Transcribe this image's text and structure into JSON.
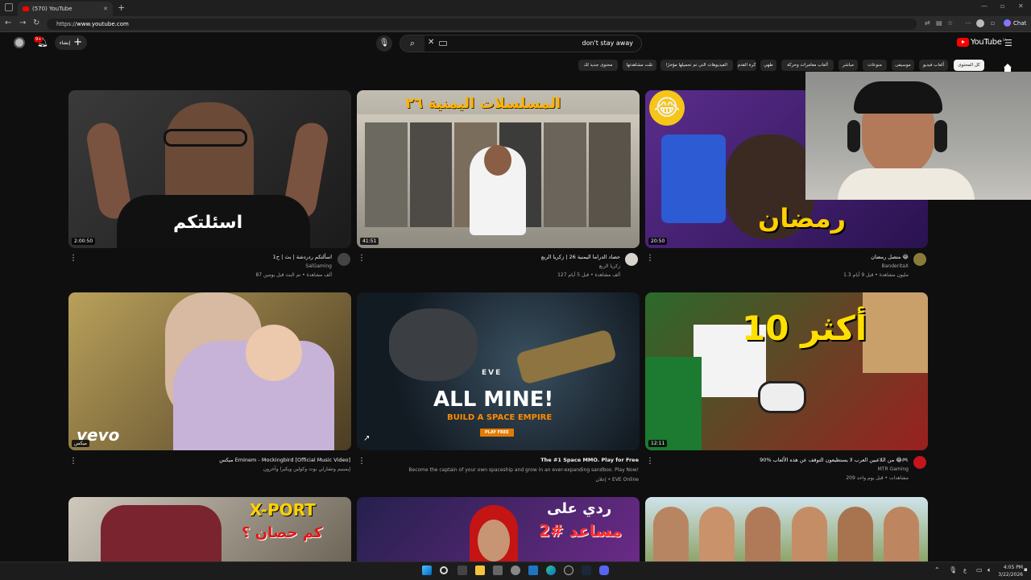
{
  "browser": {
    "tab_title": "(570) YouTube",
    "url_prefix": "https://",
    "url_host": "www.youtube.com",
    "chat_label": "Chat",
    "icons": [
      "back-icon",
      "forward-icon",
      "reload-icon",
      "site-info-icon",
      "translate-icon",
      "reader-icon",
      "star-icon",
      "more-icon",
      "profile-icon"
    ]
  },
  "youtube": {
    "create_label": "إنشاء",
    "notification_count": "9+",
    "search_query": "don't stay away",
    "logo_text": "YouTube",
    "logo_region": "SA",
    "chips": [
      {
        "label": "كل المحتوى",
        "active": true
      },
      {
        "label": "ألعاب فيديو"
      },
      {
        "label": "موسيقى"
      },
      {
        "label": "منوعات"
      },
      {
        "label": "مباشر"
      },
      {
        "label": "ألعاب مغامرات وحركة"
      },
      {
        "label": "طهي"
      },
      {
        "label": "كرة القدم"
      },
      {
        "label": "الفيديوهات التي تم تحميلها مؤخرًا"
      },
      {
        "label": "تمّت مشاهدتها"
      },
      {
        "label": "محتوى جديد لك"
      }
    ],
    "videos": [
      {
        "title": "اسألتكم ردردشة | بث | ح1",
        "channel": "SalGaming",
        "meta": "87 ألف مشاهدة • تم البث قبل يومين",
        "duration": "2:00:50",
        "overlay": "اسئلتكم"
      },
      {
        "title": "حصاد الدراما اليمنية 26 | زكريا الربع",
        "channel": "زكريا الربع",
        "meta": "127 ألف مشاهدة • قبل 5 أيام",
        "duration": "41:51",
        "overlay": "المسلسلات اليمنية ٢٦"
      },
      {
        "title": "متصل رمضان 😂",
        "channel": "BanderitaX",
        "meta": "1.3 مليون مشاهدة • قبل 9 أيام",
        "duration": "20:50",
        "overlay": "رمضان"
      },
      {
        "title": "ميكس Eminem - Mockingbird [Official Music Video]",
        "channel": "إيمينيم وتشارلي بوث وكولين ويكيرا وآخرون",
        "meta": "",
        "duration": "ميكس",
        "overlay": "vevo"
      },
      {
        "title": "The #1 Space MMO. Play for Free",
        "channel": "Become the captain of your own spaceship and grow in an ever-expanding sandbox. Play Now!",
        "meta": "إعلان • EVE Online",
        "duration": "",
        "overlay": "ALL MINE!",
        "overlay_sub": "BUILD A SPACE EMPIRE",
        "overlay_btn": "PLAY FREE",
        "overlay_logo": "EVE"
      },
      {
        "title": "90% من اللاعبين العرب لا يستطيعون التوقف عن هذه الألعاب 😂🎮",
        "channel": "MTR Gaming",
        "meta": "209 مشاهدات • قبل يوم واحد",
        "duration": "12:11",
        "overlay": "أكثر 10"
      },
      {
        "title": "",
        "channel": "",
        "meta": "",
        "duration": "",
        "overlay": "X-PORT",
        "overlay_sub": "كم حصان ؟"
      },
      {
        "title": "",
        "channel": "",
        "meta": "",
        "duration": "",
        "overlay": "ردي على",
        "overlay_sub": "مساعد #2"
      },
      {
        "title": "",
        "channel": "",
        "meta": "",
        "duration": "",
        "overlay": ""
      }
    ]
  },
  "taskbar": {
    "time": "4:05 PM",
    "date": "3/22/2026",
    "lang": "ع"
  }
}
